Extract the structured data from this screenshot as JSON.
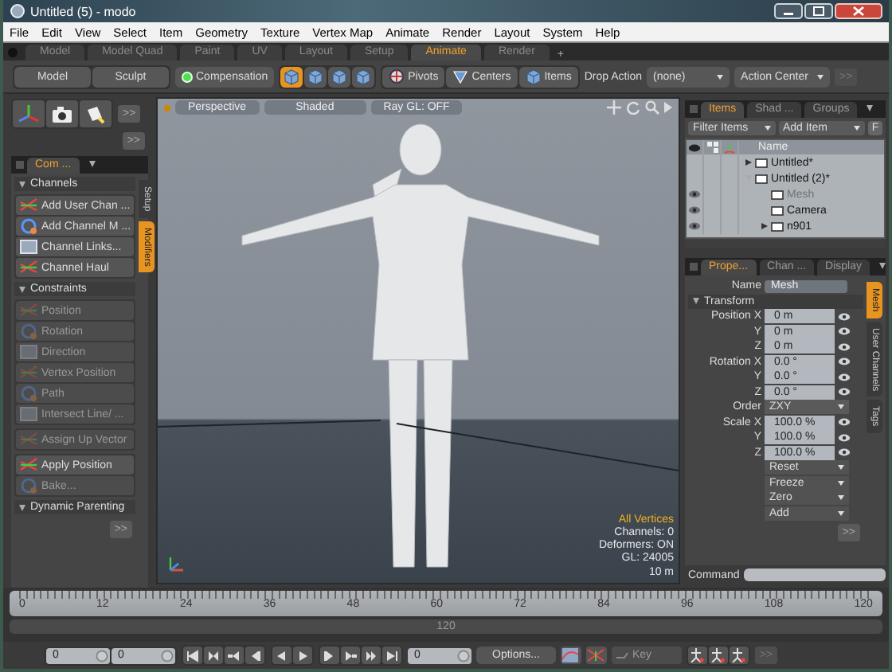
{
  "window": {
    "title": "Untitled (5) - modo"
  },
  "menu": [
    "File",
    "Edit",
    "View",
    "Select",
    "Item",
    "Geometry",
    "Texture",
    "Vertex Map",
    "Animate",
    "Render",
    "Layout",
    "System",
    "Help"
  ],
  "layout_tabs": [
    {
      "label": "Model",
      "selected": false
    },
    {
      "label": "Model Quad",
      "selected": false
    },
    {
      "label": "Paint",
      "selected": false
    },
    {
      "label": "UV",
      "selected": false
    },
    {
      "label": "Layout",
      "selected": false
    },
    {
      "label": "Setup",
      "selected": false
    },
    {
      "label": "Animate",
      "selected": true
    },
    {
      "label": "Render",
      "selected": false
    }
  ],
  "add_tab": "+",
  "toolbar": {
    "modes": [
      "Model",
      "Sculpt"
    ],
    "compensation": {
      "label": "Compensation",
      "on": true
    },
    "selection_modes": [
      {
        "selected": true
      },
      {
        "selected": false
      },
      {
        "selected": false
      },
      {
        "selected": false
      }
    ],
    "pivot_buttons": [
      "Pivots",
      "Centers",
      "Items"
    ],
    "drop_action_label": "Drop Action",
    "drop_action": "(none)",
    "action_center": "Action Center",
    "more": ">>"
  },
  "left_panel": {
    "tools_more": ">>",
    "more": ">>",
    "tabs": [
      {
        "label": "Com ...",
        "selected": true
      }
    ],
    "side_tabs": [
      {
        "label": "Setup",
        "selected": false
      },
      {
        "label": "Modifiers",
        "selected": true
      }
    ],
    "blocks": [
      {
        "kind": "header",
        "title": "Channels",
        "expanded": true
      },
      {
        "kind": "buttons",
        "buttons": [
          {
            "label": "Add User Chan ...",
            "disabled": false
          },
          {
            "label": "Add Channel M ...",
            "disabled": false
          },
          {
            "label": "Channel Links...",
            "disabled": false
          },
          {
            "label": "Channel Haul",
            "disabled": false
          }
        ]
      },
      {
        "kind": "header",
        "title": "Constraints",
        "expanded": true
      },
      {
        "kind": "buttons",
        "buttons": [
          {
            "label": "Position",
            "disabled": true
          },
          {
            "label": "Rotation",
            "disabled": true
          },
          {
            "label": "Direction",
            "disabled": true
          },
          {
            "label": "Vertex Position",
            "disabled": true
          },
          {
            "label": "Path",
            "disabled": true
          },
          {
            "label": "Intersect Line/ ...",
            "disabled": true
          }
        ]
      },
      {
        "kind": "buttons",
        "buttons": [
          {
            "label": "Assign Up Vector",
            "disabled": true
          }
        ]
      },
      {
        "kind": "buttons",
        "buttons": [
          {
            "label": "Apply Position",
            "disabled": false
          },
          {
            "label": "Bake...",
            "disabled": true
          }
        ]
      },
      {
        "kind": "header",
        "title": "Dynamic Parenting",
        "expanded": true
      }
    ],
    "bottom_more": ">>"
  },
  "viewport": {
    "buttons": [
      "Perspective",
      "Shaded",
      "Ray GL: OFF"
    ],
    "info": [
      {
        "text": "All Vertices",
        "kind": "highlight"
      },
      {
        "text": "Channels: 0",
        "kind": "plain"
      },
      {
        "text": "Deformers: ON",
        "kind": "plain"
      },
      {
        "text": "GL: 24005",
        "kind": "plain"
      },
      {
        "text": "10 m",
        "kind": "plain"
      }
    ]
  },
  "items_panel": {
    "tabs": [
      {
        "label": "Items",
        "selected": true
      },
      {
        "label": "Shad ...",
        "selected": false
      },
      {
        "label": "Groups",
        "selected": false
      }
    ],
    "filter": "Filter Items",
    "add": "Add Item",
    "f_button": "F",
    "column": "Name",
    "tree": [
      {
        "label": "Untitled*",
        "expanded": false,
        "visible": false,
        "disabled": false
      },
      {
        "label": "Untitled (2)*",
        "expanded": true,
        "visible": false,
        "disabled": false,
        "children": [
          {
            "label": "Mesh",
            "visible": true,
            "disabled": true
          },
          {
            "label": "Camera",
            "visible": true,
            "disabled": false
          },
          {
            "label": "n901",
            "expanded": false,
            "visible": true,
            "disabled": false
          }
        ]
      }
    ]
  },
  "properties": {
    "tabs": [
      {
        "label": "Prope...",
        "selected": true
      },
      {
        "label": "Chan ...",
        "selected": false
      },
      {
        "label": "Display",
        "selected": false
      }
    ],
    "side_tabs": [
      {
        "label": "Mesh",
        "selected": true
      },
      {
        "label": "User Channels",
        "selected": false
      },
      {
        "label": "Tags",
        "selected": false
      }
    ],
    "name_label": "Name",
    "name_value": "Mesh",
    "section": {
      "title": "Transform",
      "expanded": true
    },
    "rows": [
      {
        "kind": "value",
        "label": "Position X",
        "value": "0 m"
      },
      {
        "kind": "value",
        "label": "Y",
        "value": "0 m"
      },
      {
        "kind": "value",
        "label": "Z",
        "value": "0 m"
      },
      {
        "kind": "value",
        "label": "Rotation X",
        "value": "0.0 °"
      },
      {
        "kind": "value",
        "label": "Y",
        "value": "0.0 °"
      },
      {
        "kind": "value",
        "label": "Z",
        "value": "0.0 °"
      },
      {
        "kind": "dropdown",
        "label": "Order",
        "value": "ZXY"
      },
      {
        "kind": "value",
        "label": "Scale X",
        "value": "100.0 %"
      },
      {
        "kind": "value",
        "label": "Y",
        "value": "100.0 %"
      },
      {
        "kind": "value",
        "label": "Z",
        "value": "100.0 %"
      }
    ],
    "actions": [
      "Reset",
      "Freeze",
      "Zero",
      "Add"
    ],
    "more": ">>"
  },
  "command": {
    "label": "Command"
  },
  "timeline": {
    "ticks": [
      "0",
      "12",
      "24",
      "36",
      "48",
      "60",
      "72",
      "84",
      "96",
      "108",
      "120"
    ],
    "range_label": "120"
  },
  "bottom_bar": {
    "start": "0",
    "end": "0",
    "current": "0",
    "options": "Options...",
    "key": {
      "label": "Key",
      "disabled": true
    },
    "more": ">>"
  }
}
